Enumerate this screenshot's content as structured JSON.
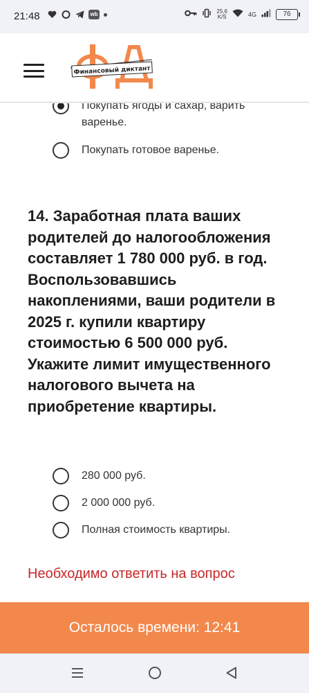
{
  "status_bar": {
    "time": "21:48",
    "net_speed_value": "25,6",
    "net_speed_unit": "K/S",
    "network_type": "4G",
    "battery": "76",
    "left_icons": [
      "heart-icon",
      "chat-icon",
      "telegram-icon",
      "wb-icon",
      "dot-icon"
    ],
    "right_icons": [
      "key-icon",
      "vibrate-icon",
      "wifi-icon",
      "signal-icon",
      "battery-icon"
    ]
  },
  "header": {
    "logo_letters": "ФД",
    "logo_banner_text": "Финансовый диктант",
    "logo_accent_color": "#f2884b"
  },
  "previous_options": [
    {
      "label": "Покупать ягоды и сахар, варить варенье.",
      "selected": true
    },
    {
      "label": "Покупать готовое варенье.",
      "selected": false
    }
  ],
  "question": {
    "text": "14. Заработная плата ваших родителей до налогообложения составляет 1 780 000 руб. в год. Воспользовавшись накоплениями, ваши родители в 2025 г. купили квартиру стоимостью 6 500 000 руб. Укажите лимит имущественного налогового вычета на приобретение квартиры.",
    "options": [
      {
        "label": "280 000 руб.",
        "selected": false
      },
      {
        "label": "2 000 000 руб.",
        "selected": false
      },
      {
        "label": "Полная стоимость квартиры.",
        "selected": false
      }
    ],
    "error": "Необходимо ответить на вопрос",
    "error_color": "#c62828"
  },
  "timer": {
    "label": "Осталось времени: 12:41",
    "color": "#f2884b"
  },
  "nav_bar": {
    "icons": [
      "recents-icon",
      "home-icon",
      "back-icon"
    ]
  }
}
